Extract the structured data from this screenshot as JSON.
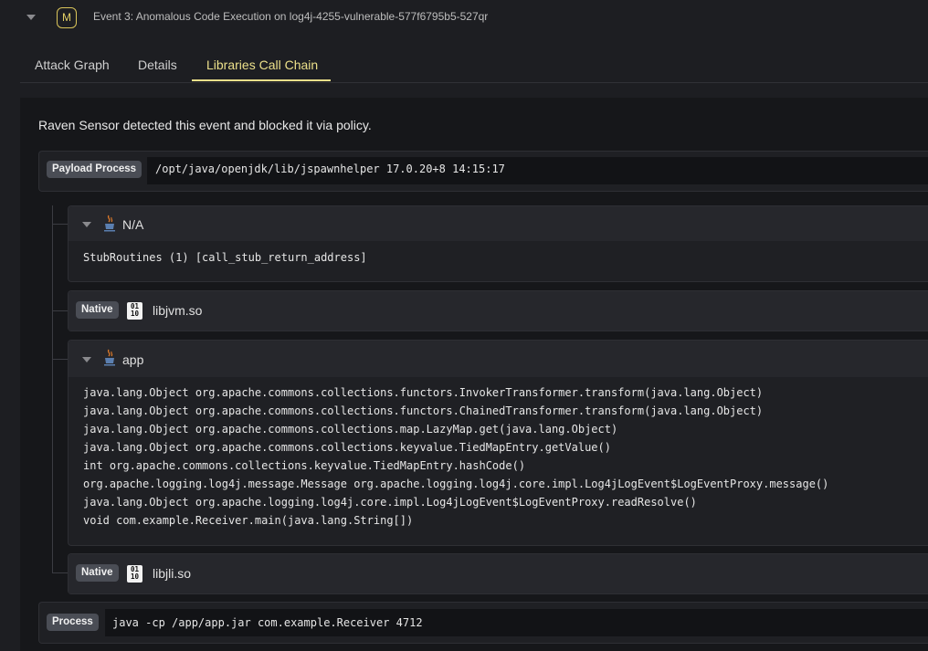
{
  "event": {
    "severity": "M",
    "title": "Event 3: Anomalous Code Execution on log4j-4255-vulnerable-577f6795b5-527qr"
  },
  "tabs": [
    {
      "label": "Attack Graph"
    },
    {
      "label": "Details"
    },
    {
      "label": "Libraries Call Chain",
      "active": true
    }
  ],
  "notice": "Raven Sensor detected this event and blocked it via policy.",
  "payload_process": {
    "badge": "Payload Process",
    "command": "/opt/java/openjdk/lib/jspawnhelper 17.0.20+8 14:15:17"
  },
  "chain": {
    "na": {
      "label": "N/A",
      "lines": [
        "StubRoutines (1) [call_stub_return_address]"
      ]
    },
    "libjvm": {
      "badge": "Native",
      "label": "libjvm.so"
    },
    "app": {
      "label": "app",
      "lines": [
        "java.lang.Object org.apache.commons.collections.functors.InvokerTransformer.transform(java.lang.Object)",
        "java.lang.Object org.apache.commons.collections.functors.ChainedTransformer.transform(java.lang.Object)",
        "java.lang.Object org.apache.commons.collections.map.LazyMap.get(java.lang.Object)",
        "java.lang.Object org.apache.commons.collections.keyvalue.TiedMapEntry.getValue()",
        "int org.apache.commons.collections.keyvalue.TiedMapEntry.hashCode()",
        "org.apache.logging.log4j.message.Message org.apache.logging.log4j.core.impl.Log4jLogEvent$LogEventProxy.message()",
        "java.lang.Object org.apache.logging.log4j.core.impl.Log4jLogEvent$LogEventProxy.readResolve()",
        "void com.example.Receiver.main(java.lang.String[])"
      ]
    },
    "libjli": {
      "badge": "Native",
      "label": "libjli.so"
    }
  },
  "process": {
    "badge": "Process",
    "command": "java -cp /app/app.jar com.example.Receiver 4712"
  },
  "icons": {
    "collapse": "chevron-down-icon",
    "java": "java-icon",
    "binary": "binary-file-icon"
  },
  "colors": {
    "accent": "#ece08a",
    "severity_medium": "#d9c45a",
    "background": "#1d1e22"
  }
}
